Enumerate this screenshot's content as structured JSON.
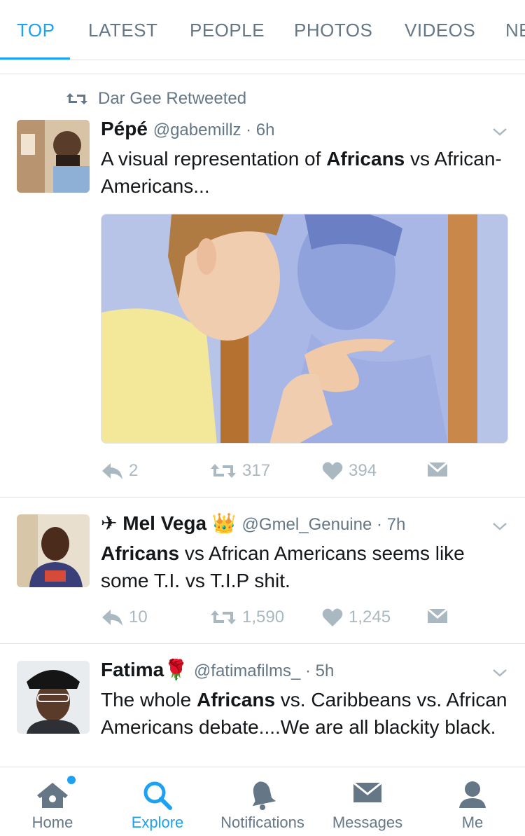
{
  "tabs": [
    "TOP",
    "LATEST",
    "PEOPLE",
    "PHOTOS",
    "VIDEOS",
    "NE"
  ],
  "tweets": [
    {
      "retweeted_by": "Dar Gee Retweeted",
      "name": "Pépé",
      "handle": "@gabemillz",
      "time": "6h",
      "text_parts": [
        "A visual representation of ",
        "Africans",
        " vs African-Americans..."
      ],
      "replies": "2",
      "retweets": "317",
      "likes": "394"
    },
    {
      "name_prefix": "✈",
      "name": "Mel Vega",
      "name_suffix": "👑",
      "handle": "@Gmel_Genuine",
      "time": "7h",
      "text_parts": [
        "Africans",
        " vs African Americans seems like some T.I. vs T.I.P shit."
      ],
      "replies": "10",
      "retweets": "1,590",
      "likes": "1,245"
    },
    {
      "name": "Fatima",
      "name_suffix": "🌹",
      "handle": "@fatimafilms_",
      "time": "5h",
      "text_parts": [
        "The whole ",
        "Africans",
        " vs. Caribbeans vs. African Americans debate....We are all blackity black."
      ]
    }
  ],
  "nav": {
    "home": "Home",
    "explore": "Explore",
    "notifications": "Notifications",
    "messages": "Messages",
    "me": "Me"
  },
  "colors": {
    "accent": "#1da1f2",
    "muted": "#657786",
    "icon_muted": "#aab8c2",
    "border": "#dfe3e6"
  }
}
